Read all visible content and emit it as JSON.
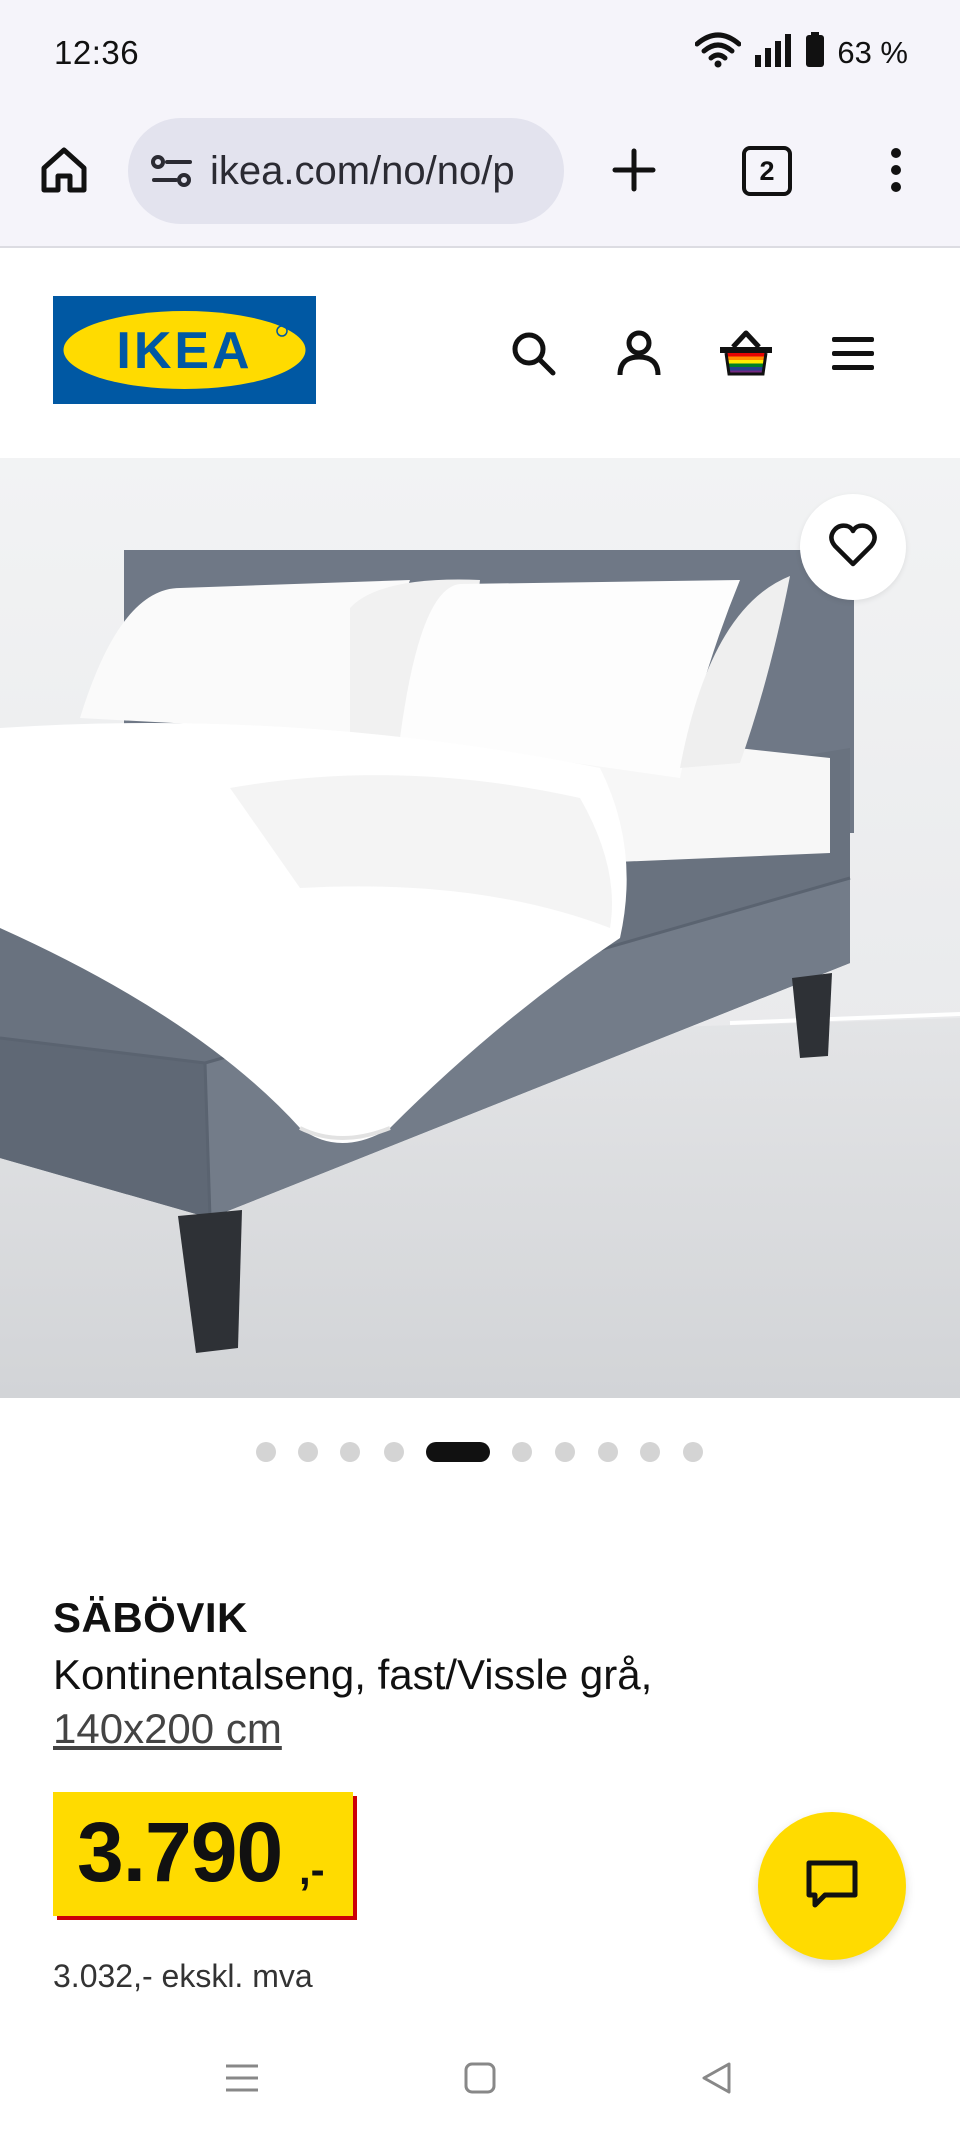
{
  "status_bar": {
    "time": "12:36",
    "battery_text": "63 %",
    "icons": [
      "wifi-icon",
      "signal-icon",
      "battery-icon"
    ]
  },
  "browser": {
    "url": "ikea.com/no/no/p",
    "tab_count": "2",
    "icons": [
      "home-icon",
      "site-info-icon",
      "new-tab-icon",
      "tabs-icon",
      "more-menu-icon"
    ]
  },
  "site_header": {
    "logo_text": "IKEA",
    "icons": [
      "search-icon",
      "account-icon",
      "basket-icon",
      "menu-icon"
    ]
  },
  "gallery": {
    "image": "bed-photo",
    "slide_count": 10,
    "active_slide": 5
  },
  "product": {
    "brand": "SÄBÖVIK",
    "description": "Kontinentalseng, fast/Vissle grå,",
    "size": "140x200 cm",
    "price_main": "3.790",
    "price_suffix": ",-",
    "price_excl": "3.032,- ekskl. mva"
  },
  "colors": {
    "ikea_blue": "#0058a3",
    "ikea_yellow": "#ffdb00",
    "price_shadow": "#cc0008"
  }
}
